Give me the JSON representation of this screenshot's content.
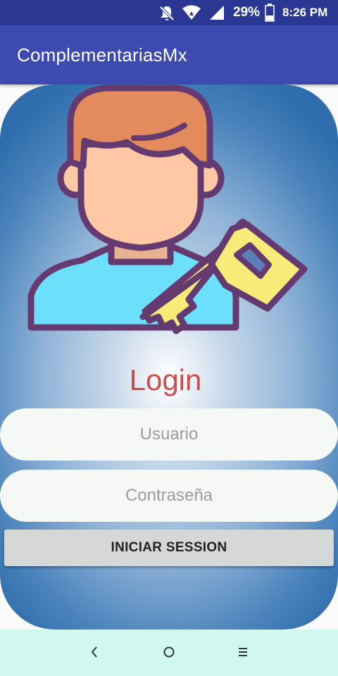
{
  "status_bar": {
    "battery_percent": "29%",
    "time": "8:26 PM",
    "icons": [
      "notifications-off-icon",
      "wifi-icon",
      "signal-icon",
      "battery-icon"
    ]
  },
  "app_bar": {
    "title": "ComplementariasMx"
  },
  "login": {
    "title": "Login",
    "username_placeholder": "Usuario",
    "password_placeholder": "Contraseña",
    "submit_label": "INICIAR SESSION"
  },
  "colors": {
    "status_bar": "#2b3893",
    "app_bar": "#3d4ab0",
    "login_title": "#cd4d4d",
    "nav_bar": "#d1f8ef"
  },
  "nav_bar": {
    "icons": [
      "back-icon",
      "home-icon",
      "recents-icon"
    ]
  }
}
